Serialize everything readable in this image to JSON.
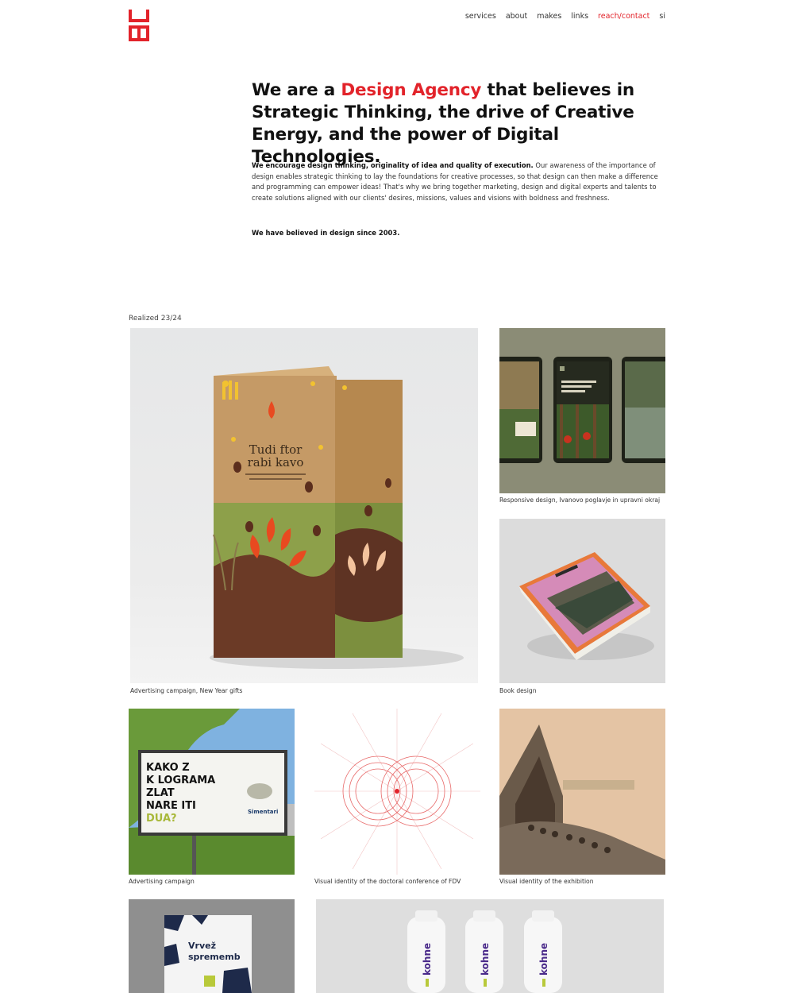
{
  "brand": {
    "logo_name": "agency-monogram",
    "accent_color": "#e2232a"
  },
  "nav": {
    "items": [
      {
        "label": "services"
      },
      {
        "label": "about"
      },
      {
        "label": "makes"
      },
      {
        "label": "links"
      },
      {
        "label": "reach/contact",
        "accent": true
      },
      {
        "label": "si"
      }
    ]
  },
  "hero": {
    "title_pre": "We are a ",
    "title_accent": "Design Agency",
    "title_post": " that believes in Strategic Thinking, the drive of Creative Energy, and the power of Digital Technologies.",
    "intro_bold": "We encourage design thinking, originality of idea and quality of execution.",
    "intro_rest": " Our awareness of the importance of design enables strategic thinking to lay the foundations for creative processes, so that design can then make a difference and programming can empower ideas! That's why we bring together marketing, design and digital experts and talents to create solutions aligned with our clients' desires, missions, values and visions with boldness and freshness.",
    "since": "We have believed in design since 2003."
  },
  "projects": {
    "label": "Realized 23/24",
    "items": [
      {
        "caption": "Advertising campaign, New Year gifts",
        "box_text_1": "Tudi ftor",
        "box_text_2": "rabi kavo"
      },
      {
        "caption": "Responsive design, Ivanovo poglavje in upravni okraj"
      },
      {
        "caption": "Book design"
      },
      {
        "caption": "Advertising campaign",
        "billboard_line_1": "KAKO  Z",
        "billboard_line_2": "K LOGRAMA",
        "billboard_line_3": "ZLAT",
        "billboard_line_4": "NARE   ITI",
        "billboard_line_5": "DUA?",
        "billboard_brand": "Simentari"
      },
      {
        "caption": "Visual identity of the doctoral conference of FDV"
      },
      {
        "caption": "Visual identity of the exhibition"
      },
      {
        "caption": "",
        "poster_text_1": "Vrvež",
        "poster_text_2": "sprememb"
      },
      {
        "caption": "",
        "bottle_label": "kohne"
      }
    ]
  }
}
